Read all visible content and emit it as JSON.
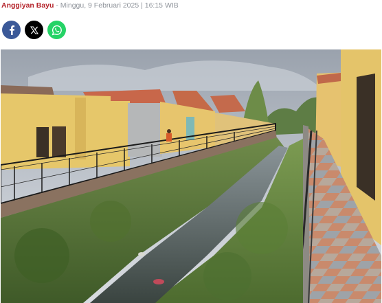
{
  "byline": {
    "author": "Anggiyan Bayu",
    "separator": " - ",
    "date": "Minggu, 9 Februari 2025 | 16:15 WIB"
  },
  "share": {
    "buttons": [
      {
        "icon": "facebook-icon",
        "color": "#3b5998"
      },
      {
        "icon": "x-icon",
        "color": "#000000"
      },
      {
        "icon": "whatsapp-icon",
        "color": "#25d366"
      }
    ]
  },
  "photo": {
    "subject": "canal-between-houses"
  },
  "colors": {
    "author": "#b4232a",
    "meta": "#8f949b"
  }
}
